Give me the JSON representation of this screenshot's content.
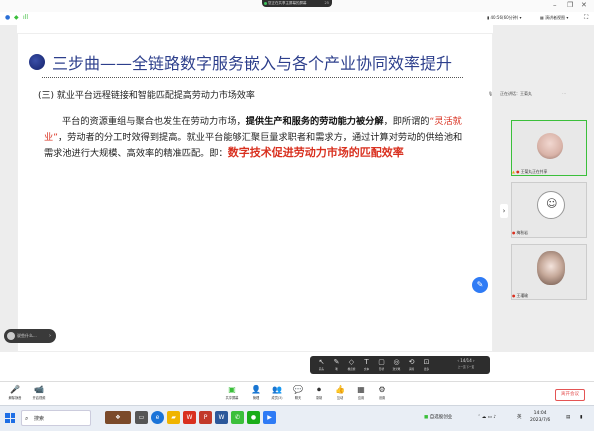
{
  "window": {
    "sharing_label": "您正在共享主屏幕的屏幕",
    "sharing_count": "25",
    "minimize": "–",
    "restore": "❐",
    "close": "✕"
  },
  "top_toolbar": {
    "time_label": "40:56(60分钟)",
    "view_label": "演讲者视图"
  },
  "slide": {
    "title": "三步曲——全链路数字服务嵌入与各个产业协同效率提升",
    "subtitle": "(三) 就业平台远程链接和智能匹配提高劳动力市场效率",
    "para_1": "平台的资源重组与聚合也发生在劳动力市场，",
    "para_bold_1": "提供生产和服务的劳动能力被分解",
    "para_2": "，即所谓的",
    "para_red_1": "“灵活就业”",
    "para_3": "，劳动者的分工时效得到提高。就业平台能够汇聚巨量求职者和需求方，通过计算对劳动的供给池和需求池进行大规模、高效率的精准匹配。即：",
    "para_red_bold": "数字技术促进劳动力市场的匹配效率"
  },
  "chat": {
    "preview": "说些什么..."
  },
  "sidebar": {
    "speaker_label": "正在讲话：王菊丸",
    "tiles": [
      {
        "label": "王菊丸正在共享"
      },
      {
        "label": "梅秋岩"
      },
      {
        "label": "王瑾瑜"
      }
    ]
  },
  "slide_tools": [
    {
      "glyph": "↖",
      "label": "箭头"
    },
    {
      "glyph": "✎",
      "label": "笔"
    },
    {
      "glyph": "◇",
      "label": "橡皮擦"
    },
    {
      "glyph": "T",
      "label": "文本"
    },
    {
      "glyph": "▢",
      "label": "形状"
    },
    {
      "glyph": "◎",
      "label": "激光笔"
    },
    {
      "glyph": "⟲",
      "label": "清除"
    },
    {
      "glyph": "⊡",
      "label": "更多"
    }
  ],
  "page_indicator": {
    "text": "14/14",
    "prev": "上一页",
    "next": "下一页"
  },
  "meeting_toolbar": {
    "left": [
      {
        "glyph": "🎤",
        "label": "解除静音"
      },
      {
        "glyph": "📹",
        "label": "开启视频"
      }
    ],
    "center": [
      {
        "glyph": "▣",
        "label": "共享屏幕"
      },
      {
        "glyph": "👤",
        "label": "管理"
      },
      {
        "glyph": "👥",
        "label": "成员(3)"
      },
      {
        "glyph": "💬",
        "label": "聊天"
      },
      {
        "glyph": "⏺",
        "label": "录制"
      },
      {
        "glyph": "👍",
        "label": "互动"
      },
      {
        "glyph": "▦",
        "label": "应用"
      },
      {
        "glyph": "⚙",
        "label": "设置"
      }
    ],
    "leave_label": "离开会议"
  },
  "taskbar": {
    "search_placeholder": "搜索",
    "tray_app": "自选股创业",
    "lang": "英",
    "time": "14:04",
    "date": "2023/7/6"
  }
}
